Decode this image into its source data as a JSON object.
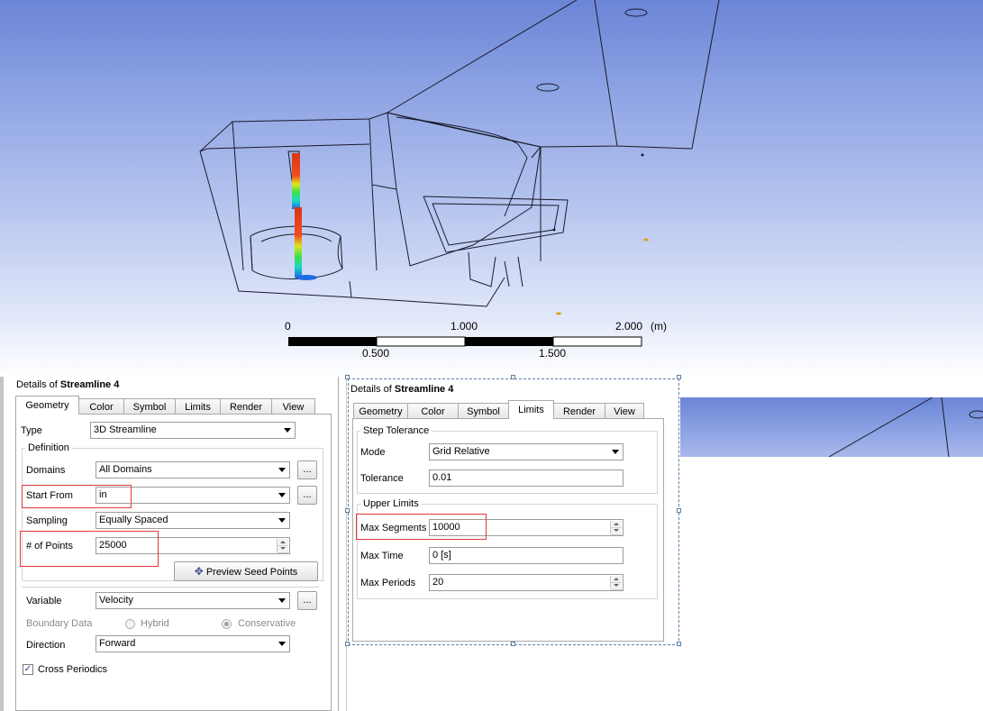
{
  "scale": {
    "labels_top": [
      "0",
      "1.000",
      "2.000"
    ],
    "unit": "(m)",
    "labels_bottom": [
      "0.500",
      "1.500"
    ]
  },
  "left_panel": {
    "title_prefix": "Details of",
    "title_name": "Streamline 4",
    "tabs": [
      "Geometry",
      "Color",
      "Symbol",
      "Limits",
      "Render",
      "View"
    ],
    "active_tab": "Geometry",
    "type_label": "Type",
    "type_value": "3D Streamline",
    "definition_label": "Definition",
    "domains_label": "Domains",
    "domains_value": "All Domains",
    "start_from_label": "Start From",
    "start_from_value": "in",
    "sampling_label": "Sampling",
    "sampling_value": "Equally Spaced",
    "points_label": "# of Points",
    "points_value": "25000",
    "preview_button": "Preview Seed Points",
    "variable_label": "Variable",
    "variable_value": "Velocity",
    "boundary_label": "Boundary Data",
    "boundary_options": [
      "Hybrid",
      "Conservative"
    ],
    "boundary_selected": "Conservative",
    "direction_label": "Direction",
    "direction_value": "Forward",
    "cross_periodics_label": "Cross Periodics",
    "cross_periodics_checked": true,
    "ellipsis": "..."
  },
  "right_panel": {
    "title_prefix": "Details of",
    "title_name": "Streamline 4",
    "tabs": [
      "Geometry",
      "Color",
      "Symbol",
      "Limits",
      "Render",
      "View"
    ],
    "active_tab": "Limits",
    "step_tolerance_label": "Step Tolerance",
    "mode_label": "Mode",
    "mode_value": "Grid Relative",
    "tolerance_label": "Tolerance",
    "tolerance_value": "0.01",
    "upper_limits_label": "Upper Limits",
    "max_segments_label": "Max Segments",
    "max_segments_value": "10000",
    "max_time_label": "Max Time",
    "max_time_value": "0 [s]",
    "max_periods_label": "Max Periods",
    "max_periods_value": "20"
  },
  "colors": {
    "viewport_top": "#6b85d6",
    "highlight_red": "#e03a3a",
    "selection_dash": "#5d7fa8"
  }
}
